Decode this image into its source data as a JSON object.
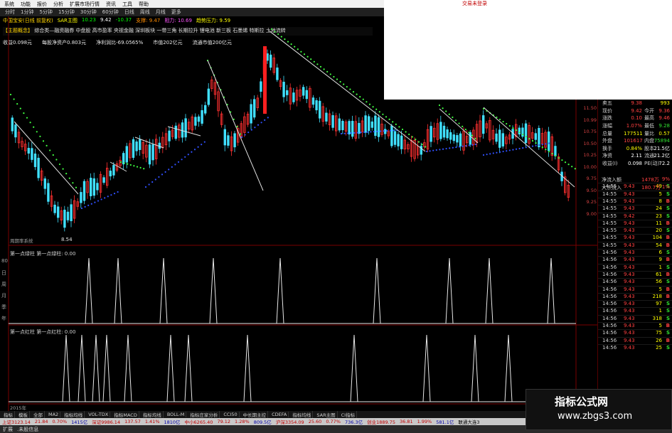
{
  "menu": {
    "items": [
      "系统",
      "功能",
      "报价",
      "分析",
      "扩展市场行情",
      "资讯",
      "工具",
      "帮助"
    ],
    "right_text": "交易未登录",
    "right_text2": "中国宝"
  },
  "periods": [
    "分时",
    "1分钟",
    "5分钟",
    "15分钟",
    "30分钟",
    "60分钟",
    "日线",
    "周线",
    "月线",
    "更多"
  ],
  "info": {
    "stock": "中国宝安(日线 前复权)",
    "indicator": "SAR主图",
    "main_value": "10.23",
    "upper_value": "9.42",
    "lower_label": "-10.37",
    "tag1": "支撑: 9.47",
    "tag2": "阻力: 10.69",
    "tag3": "趋势压力: 9.59"
  },
  "news": {
    "lead": "【主题概念】",
    "text": "综合类—融资融券 中盘股 高市盈率 央视金融 深圳板块 一带三角 长期拉升 锂电池 新三板 石墨烯 特斯拉 土地流转"
  },
  "fund": {
    "eps": "收益0.098元",
    "nav": "每股净资产0.803元",
    "profit": "净利润比-69.0565%",
    "mktcap": "市值202亿元",
    "float_cap": "流通市值200亿元"
  },
  "chart_labels": {
    "low_mark": "8.54",
    "vol_label": "周期率系统",
    "ind1": "第一点绿柱  第一点绿柱: 0.00",
    "ind2": "第一点红柱  第一点红柱: 0.00",
    "year": "2015年"
  },
  "left_axis": [
    "80",
    "日",
    "周",
    "月",
    "季",
    "年"
  ],
  "price_scale": [
    "11.50",
    "10.99",
    "10.75",
    "10.50",
    "10.25",
    "10.00",
    "9.75",
    "9.50",
    "9.25",
    "9.00"
  ],
  "quote": {
    "rows": [
      {
        "l1": "卖五",
        "v1": "9.38",
        "l2": "",
        "v2": "993",
        "c1": "red",
        "c2": "yel"
      },
      {
        "l1": "现价",
        "v1": "9.42",
        "l2": "今开",
        "v2": "9.36",
        "c1": "red",
        "c2": "red"
      },
      {
        "l1": "涨跌",
        "v1": "0.10",
        "l2": "最高",
        "v2": "9.46",
        "c1": "red",
        "c2": "red"
      },
      {
        "l1": "涨幅",
        "v1": "1.07%",
        "l2": "最低",
        "v2": "9.28",
        "c1": "red",
        "c2": "grn"
      },
      {
        "l1": "总量",
        "v1": "177511",
        "l2": "量比",
        "v2": "0.57",
        "c1": "yel",
        "c2": "yel"
      },
      {
        "l1": "外盘",
        "v1": "101617",
        "l2": "内盘",
        "v2": "75894",
        "c1": "red",
        "c2": "grn"
      },
      {
        "l1": "换手",
        "v1": "0.84%",
        "l2": "股本",
        "v2": "21.5亿",
        "c1": "yel",
        "c2": "wht"
      },
      {
        "l1": "净资",
        "v1": "2.11",
        "l2": "流通",
        "v2": "21.2亿",
        "c1": "wht",
        "c2": "wht"
      },
      {
        "l1": "收益(I)",
        "v1": "0.098",
        "l2": "PE(动)",
        "v2": "72.2",
        "c1": "wht",
        "c2": "wht"
      }
    ],
    "flow1": {
      "label": "净流入额",
      "value": "1478万",
      "pct": "9%"
    },
    "flow2": {
      "label": "大宗流入",
      "value": "180.7万",
      "pct": "1%"
    }
  },
  "ticks": [
    {
      "t": "14:55",
      "p": "9.43",
      "q": "49",
      "d": "S",
      "dc": "grn"
    },
    {
      "t": "14:55",
      "p": "9.43",
      "q": "5",
      "d": "S",
      "dc": "grn"
    },
    {
      "t": "14:55",
      "p": "9.43",
      "q": "8",
      "d": "B",
      "dc": "red"
    },
    {
      "t": "14:55",
      "p": "9.43",
      "q": "24",
      "d": "S",
      "dc": "grn"
    },
    {
      "t": "14:55",
      "p": "9.42",
      "q": "23",
      "d": "S",
      "dc": "grn"
    },
    {
      "t": "14:55",
      "p": "9.43",
      "q": "11",
      "d": "B",
      "dc": "red"
    },
    {
      "t": "14:55",
      "p": "9.43",
      "q": "20",
      "d": "S",
      "dc": "grn"
    },
    {
      "t": "14:55",
      "p": "9.43",
      "q": "104",
      "d": "B",
      "dc": "red"
    },
    {
      "t": "14:55",
      "p": "9.43",
      "q": "54",
      "d": "B",
      "dc": "red"
    },
    {
      "t": "14:56",
      "p": "9.43",
      "q": "6",
      "d": "S",
      "dc": "grn"
    },
    {
      "t": "14:56",
      "p": "9.43",
      "q": "9",
      "d": "B",
      "dc": "red"
    },
    {
      "t": "14:56",
      "p": "9.43",
      "q": "1",
      "d": "S",
      "dc": "grn"
    },
    {
      "t": "14:56",
      "p": "9.43",
      "q": "61",
      "d": "B",
      "dc": "red"
    },
    {
      "t": "14:56",
      "p": "9.43",
      "q": "56",
      "d": "S",
      "dc": "grn"
    },
    {
      "t": "14:56",
      "p": "9.43",
      "q": "5",
      "d": "B",
      "dc": "red"
    },
    {
      "t": "14:56",
      "p": "9.43",
      "q": "218",
      "d": "B",
      "dc": "red"
    },
    {
      "t": "14:56",
      "p": "9.43",
      "q": "97",
      "d": "S",
      "dc": "grn"
    },
    {
      "t": "14:56",
      "p": "9.43",
      "q": "1",
      "d": "S",
      "dc": "grn"
    },
    {
      "t": "14:56",
      "p": "9.43",
      "q": "318",
      "d": "S",
      "dc": "grn"
    },
    {
      "t": "14:56",
      "p": "9.43",
      "q": "5",
      "d": "B",
      "dc": "red"
    },
    {
      "t": "14:56",
      "p": "9.43",
      "q": "75",
      "d": "S",
      "dc": "grn"
    },
    {
      "t": "14:56",
      "p": "9.43",
      "q": "26",
      "d": "B",
      "dc": "red"
    },
    {
      "t": "14:56",
      "p": "9.43",
      "q": "25",
      "d": "S",
      "dc": "grn"
    }
  ],
  "bottom_tabs": [
    "指标",
    "模板",
    "全部",
    "MA2",
    "指标均线",
    "VOL-TDX",
    "指标MACD",
    "指标均线",
    "BOLL-M",
    "指标庄家分析",
    "CCI50",
    "中长期主控",
    "CDEFA",
    "指标均线",
    "SAR主图",
    "CI指标"
  ],
  "status": {
    "sh": "上证3123.14",
    "sh_chg": "21.84",
    "sh_pct": "0.70%",
    "sh_amt": "1415亿",
    "sz": "深证9986.14",
    "sz_chg": "137.57",
    "sz_pct": "1.41%",
    "sz_amt": "1810亿",
    "zx": "中小6265.40",
    "zx_chg": "79.12",
    "zx_pct": "1.28%",
    "zx_amt": "809.5亿",
    "hs": "沪深3354.09",
    "hs_chg": "25.60",
    "hs_pct": "0.77%",
    "hs_amt": "736.3亿",
    "cy": "创业1889.75",
    "cy_chg": "36.81",
    "cy_pct": "1.99%",
    "cy_amt": "581.1亿",
    "right": "联通大连3"
  },
  "tabs": [
    "扩展",
    ".未股信息"
  ],
  "watermark": {
    "line1": "指标公式网",
    "line2": "www.zbgs3.com"
  },
  "colors": {
    "up": "#ff3030",
    "down": "#40e0ff",
    "sar_up": "#40ff40",
    "sar_down": "#3050ff"
  }
}
